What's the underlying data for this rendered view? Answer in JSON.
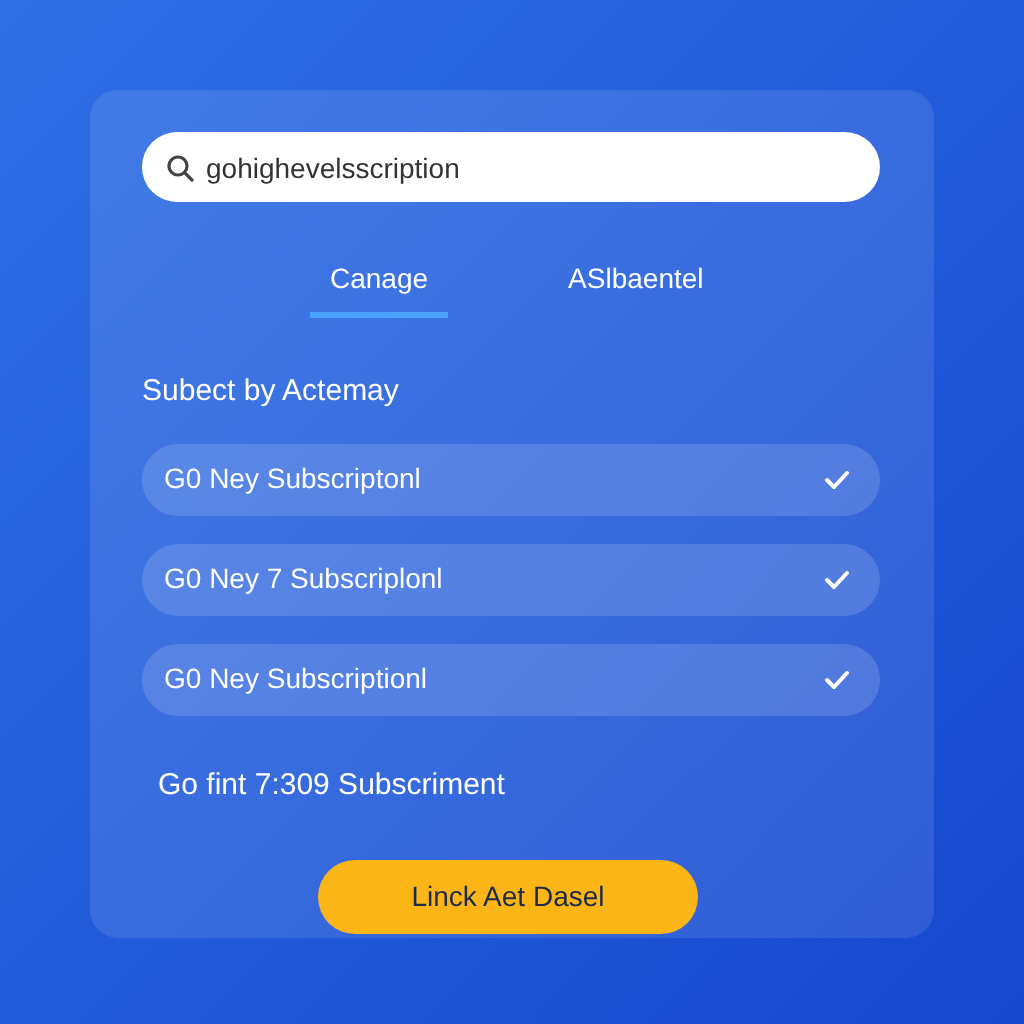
{
  "search": {
    "value": "gohighevelsscription"
  },
  "tabs": [
    {
      "label": "Canage",
      "selected": true
    },
    {
      "label": "ASlbaentel",
      "selected": false
    }
  ],
  "heading": "Subect by Actemay",
  "options": [
    {
      "label": "G0 Ney Subscriptonl",
      "checked": true
    },
    {
      "label": "G0 Ney 7 Subscriplonl",
      "checked": true
    },
    {
      "label": "G0 Ney Subscriptionl",
      "checked": true
    }
  ],
  "note": "Go fint 7:309 Subscriment",
  "button": "Linck Aet Dasel"
}
